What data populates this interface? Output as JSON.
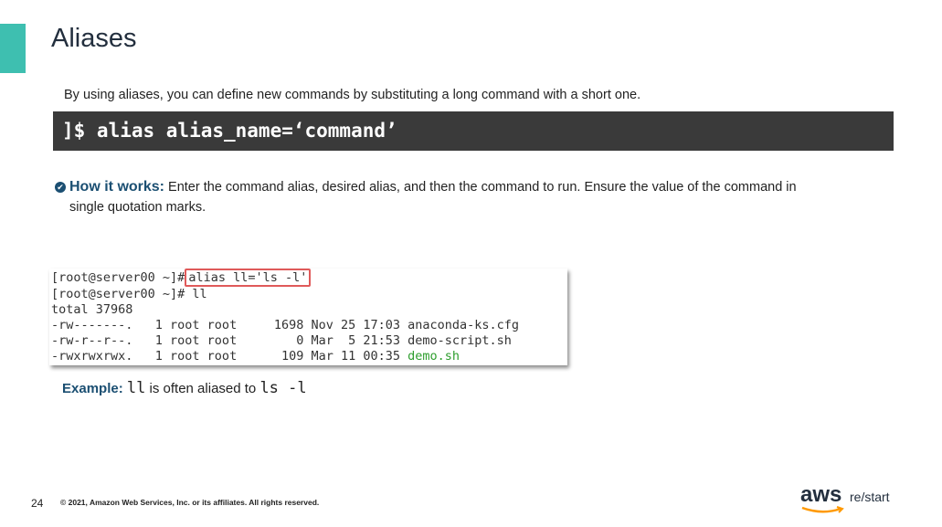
{
  "slide": {
    "title": "Aliases",
    "intro": "By using aliases, you can define new commands by substituting a long command with a short one.",
    "syntax": "]$ alias alias_name=‘command’",
    "how_label": "How it works:",
    "how_text_1": "Enter the command alias, desired alias, and then the command to run. Ensure the value of the command in",
    "how_text_2": "single quotation marks.",
    "terminal": {
      "prompt1": "[root@server00 ~]#",
      "alias_cmd": "alias ll='ls -l'",
      "line2": "[root@server00 ~]# ll",
      "line3": "total 37968",
      "row1": "-rw-------.   1 root root     1698 Nov 25 17:03 anaconda-ks.cfg",
      "row2": "-rw-r--r--.   1 root root        0 Mar  5 21:53 demo-script.sh",
      "row3_prefix": "-rwxrwxrwx.   1 root root      109 Mar 11 00:35 ",
      "row3_file": "demo.sh"
    },
    "example_label": "Example:",
    "example_code1": "ll",
    "example_mid": " is often aliased to ",
    "example_code2": "ls -l",
    "page_number": "24",
    "copyright": "© 2021, Amazon Web Services, Inc. or its affiliates. All rights reserved.",
    "logo_aws": "aws",
    "logo_restart": "re/start"
  },
  "colors": {
    "accent": "#3ebfb0",
    "heading_blue": "#1b4f72",
    "command_bar": "#3a3a3a",
    "highlight_box": "#e05a5a",
    "exec_green": "#2e9e2e",
    "logo_orange": "#ff9900"
  }
}
